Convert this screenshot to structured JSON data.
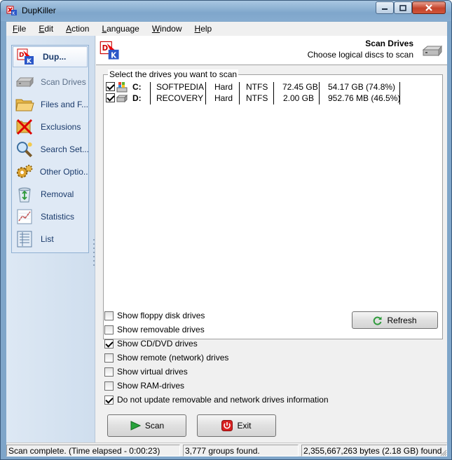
{
  "window": {
    "title": "DupKiller"
  },
  "menu": [
    {
      "label": "File",
      "u": "F",
      "rest": "ile"
    },
    {
      "label": "Edit",
      "u": "E",
      "rest": "dit"
    },
    {
      "label": "Action",
      "u": "A",
      "rest": "ction"
    },
    {
      "label": "Language",
      "u": "L",
      "rest": "anguage"
    },
    {
      "label": "Window",
      "u": "W",
      "rest": "indow"
    },
    {
      "label": "Help",
      "u": "H",
      "rest": "elp"
    }
  ],
  "nav": {
    "header": "Dup...",
    "items": [
      {
        "label": "Scan Drives",
        "icon": "hard-drive-icon",
        "disabled": true
      },
      {
        "label": "Files and F...",
        "icon": "folder-icon"
      },
      {
        "label": "Exclusions",
        "icon": "exclusions-icon"
      },
      {
        "label": "Search Set...",
        "icon": "magnifier-icon"
      },
      {
        "label": "Other Optio...",
        "icon": "gears-icon"
      },
      {
        "label": "Removal",
        "icon": "recycle-bin-icon"
      },
      {
        "label": "Statistics",
        "icon": "statistics-icon"
      },
      {
        "label": "List",
        "icon": "list-icon"
      }
    ]
  },
  "header": {
    "title": "Scan Drives",
    "subtitle": "Choose logical discs to scan"
  },
  "drives": {
    "caption": "Select the drives you want to scan",
    "rows": [
      {
        "checked": true,
        "letter": "C:",
        "label": "SOFTPEDIA",
        "type": "Hard",
        "fs": "NTFS",
        "size": "72.45 GB",
        "free": "54.17 GB (74.8%)",
        "icon": "windows-drive-icon"
      },
      {
        "checked": true,
        "letter": "D:",
        "label": "RECOVERY",
        "type": "Hard",
        "fs": "NTFS",
        "size": "2.00 GB",
        "free": "952.76 MB (46.5%)",
        "icon": "hard-drive-icon"
      }
    ]
  },
  "options": [
    {
      "label": "Show floppy disk drives",
      "checked": false
    },
    {
      "label": "Show removable drives",
      "checked": false
    },
    {
      "label": "Show CD/DVD drives",
      "checked": true
    },
    {
      "label": "Show remote (network) drives",
      "checked": false
    },
    {
      "label": "Show virtual drives",
      "checked": false
    },
    {
      "label": "Show RAM-drives",
      "checked": false
    },
    {
      "label": "Do not update removable and network drives information",
      "checked": true
    }
  ],
  "buttons": {
    "refresh": "Refresh",
    "scan": "Scan",
    "exit": "Exit"
  },
  "status": {
    "left": "Scan complete. (Time elapsed - 0:00:23)",
    "middle": "3,777 groups found.",
    "right": "2,355,667,263 bytes (2.18 GB) found"
  },
  "colors": {
    "accent": "#7ea5c9",
    "nav_text": "#1a3a6b"
  }
}
